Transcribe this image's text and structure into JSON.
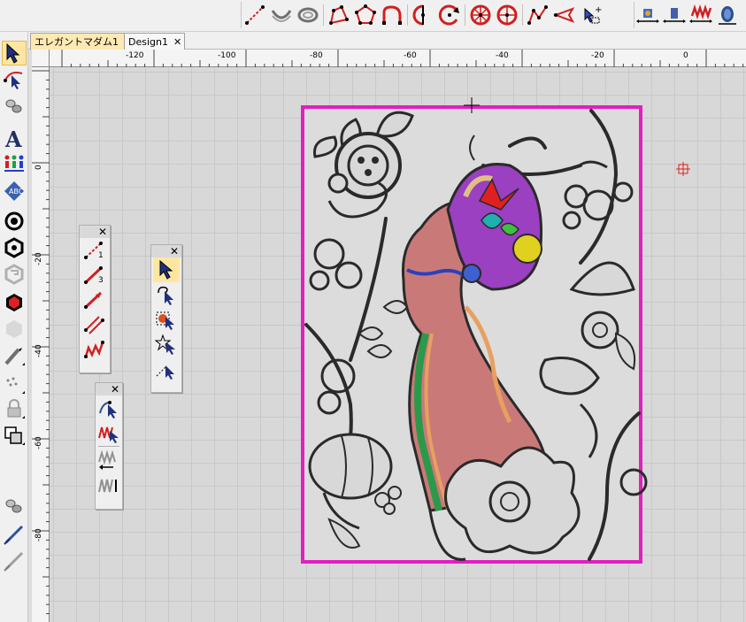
{
  "tabs": [
    {
      "label": "エレガントマダム1",
      "close": "✕",
      "active": true
    },
    {
      "label": "Design1",
      "close": "✕",
      "active": false
    }
  ],
  "ruler_top": [
    "-120",
    "-100",
    "-80",
    "-60",
    "-40",
    "-20",
    "0"
  ],
  "ruler_left": [
    "0",
    "-20",
    "-40",
    "-60",
    "-80"
  ],
  "palettes": {
    "line_tools": {
      "close": "✕",
      "labels": [
        "1",
        "3"
      ]
    },
    "select_tools": {
      "close": "✕"
    },
    "stitch_tools": {
      "close": "✕"
    }
  },
  "colors": {
    "frame": "#e020c0",
    "toolbar_bg": "#f0f0f0",
    "tab_active": "#ffe9b3",
    "selection": "#ffe6a0",
    "canvas": "#d8d8d8"
  },
  "icons": {
    "top_toolbar": [
      "line-tool-icon",
      "arc-tool-icon",
      "ring-tool-icon",
      "polygon-tool-icon",
      "pentagon-tool-icon",
      "curve-tool-icon",
      "split-tool-icon",
      "rotate-tool-icon",
      "wheel-tool-icon",
      "circle-tool-icon",
      "zigzag-tool-icon",
      "arrow-tool-icon",
      "add-point-icon",
      "stitch-preview-icon",
      "stitch-preview2-icon",
      "satin-preview-icon",
      "bobbin-preview-icon"
    ],
    "left_toolbar": [
      "select-arrow-icon",
      "node-edit-icon",
      "spools-icon",
      "text-tool-icon",
      "people-icon",
      "monogram-icon",
      "ring-icon",
      "hexagon-ring-icon",
      "spiral-icon",
      "hexagon-red-icon",
      "hexagon-faded-icon",
      "pen-tool-icon",
      "dots-icon",
      "lock-icon",
      "shapes-icon",
      "spools2-icon",
      "needle-icon",
      "needle-faded-icon"
    ]
  }
}
